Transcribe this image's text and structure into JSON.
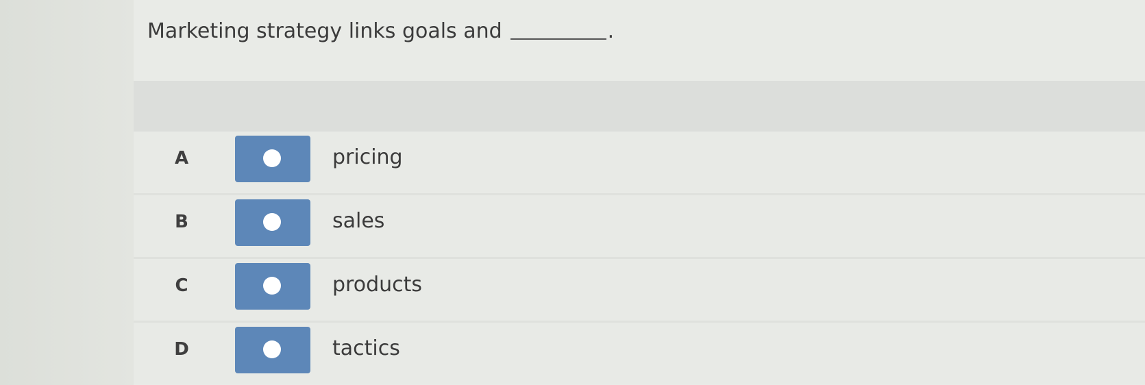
{
  "question": {
    "text": "Marketing strategy links goals and",
    "period": "."
  },
  "options": [
    {
      "letter": "A",
      "text": "pricing"
    },
    {
      "letter": "B",
      "text": "sales"
    },
    {
      "letter": "C",
      "text": "products"
    },
    {
      "letter": "D",
      "text": "tactics"
    }
  ],
  "colors": {
    "radio_box": "#5d87b8",
    "background": "#e9ebe7"
  }
}
